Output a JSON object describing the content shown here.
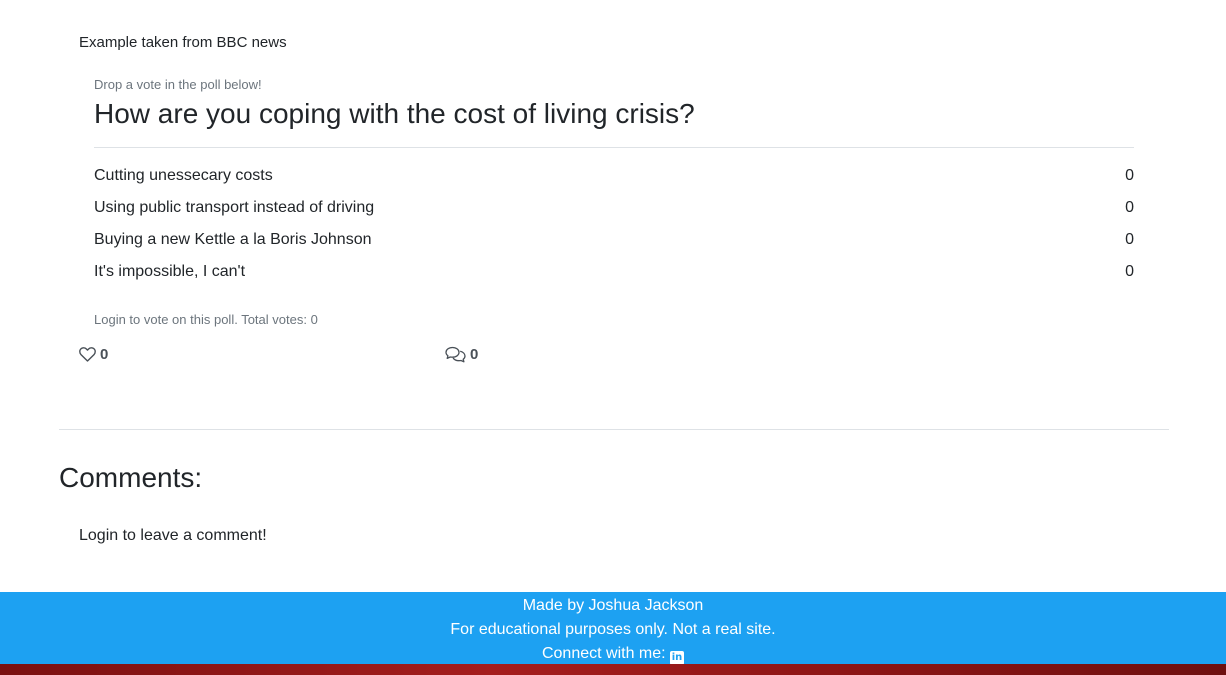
{
  "source_note": "Example taken from BBC news",
  "poll": {
    "intro": "Drop a vote in the poll below!",
    "question": "How are you coping with the cost of living crisis?",
    "options": [
      {
        "label": "Cutting unessecary costs",
        "count": "0"
      },
      {
        "label": "Using public transport instead of driving",
        "count": "0"
      },
      {
        "label": "Buying a new Kettle a la Boris Johnson",
        "count": "0"
      },
      {
        "label": "It's impossible, I can't",
        "count": "0"
      }
    ],
    "footer": "Login to vote on this poll. Total votes: 0"
  },
  "stats": {
    "likes": "0",
    "likes_icon": "heart-icon",
    "comments": "0",
    "comments_icon": "chat-bubbles-icon"
  },
  "comments": {
    "heading": "Comments:",
    "login_prompt": "Login to leave a comment!"
  },
  "footer": {
    "made_by": "Made by Joshua Jackson",
    "disclaimer": "For educational purposes only. Not a real site.",
    "connect": "Connect with me:",
    "connect_icon": "linkedin-icon",
    "background_color": "#1da1f2"
  }
}
